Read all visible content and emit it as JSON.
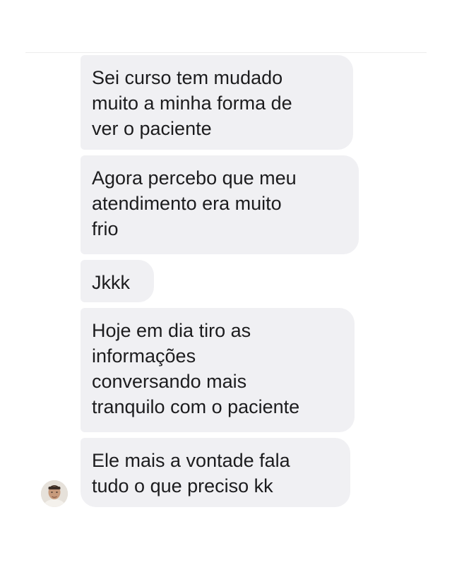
{
  "messages": [
    {
      "text": "Sei curso tem mudado\nmuito a minha forma de\nver o paciente"
    },
    {
      "text": "Agora percebo que meu\natendimento era muito\nfrio"
    },
    {
      "text": "Jkkk"
    },
    {
      "text": "Hoje em dia tiro as\ninformações\nconversando mais\ntranquilo com o paciente"
    },
    {
      "text": "Ele mais a vontade  fala\ntudo o que preciso kk"
    }
  ],
  "colors": {
    "bubble_background": "#f0f0f3",
    "text": "#1c1c1e",
    "background": "#ffffff"
  },
  "icons": {
    "avatar": "sender-avatar-photo"
  }
}
